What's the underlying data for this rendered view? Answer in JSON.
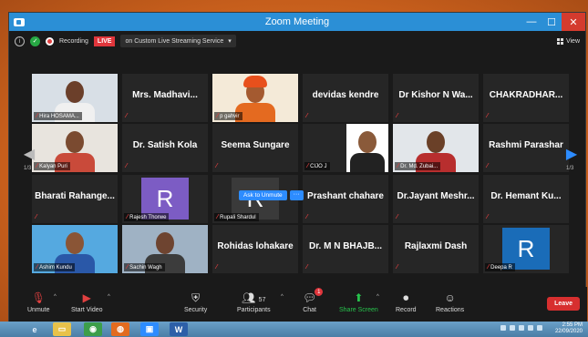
{
  "window": {
    "title": "Zoom Meeting"
  },
  "topbar": {
    "recording_label": "Recording",
    "live_label": "LIVE",
    "stream_label": "on Custom Live Streaming Service",
    "view_label": "View"
  },
  "pagination": {
    "left": "1/3",
    "right": "1/3"
  },
  "hover": {
    "ask_to_unmute": "Ask to Unmute",
    "more": "···"
  },
  "tiles": [
    {
      "name": "Hira HOSAMA...",
      "kind": "photo"
    },
    {
      "name": "Mrs. Madhavi...",
      "kind": "name"
    },
    {
      "name": "p gahvir",
      "kind": "photo"
    },
    {
      "name": "devidas kendre",
      "kind": "name"
    },
    {
      "name": "Dr Kishor N Wa...",
      "kind": "name"
    },
    {
      "name": "CHAKRADHAR...",
      "kind": "name"
    },
    {
      "name": "Kalyan Puri",
      "kind": "photo"
    },
    {
      "name": "Dr. Satish Kola",
      "kind": "name"
    },
    {
      "name": "Seema Sungare",
      "kind": "name"
    },
    {
      "name": "CIJO J",
      "kind": "photo"
    },
    {
      "name": "Dr. Md. Zubai...",
      "kind": "photo"
    },
    {
      "name": "Rashmi Parashar",
      "kind": "name"
    },
    {
      "name": "Bharati  Rahange...",
      "kind": "name"
    },
    {
      "name": "Rajesh Thorwe",
      "kind": "avatar",
      "initial": "R",
      "color": "#7c5cc4"
    },
    {
      "name": "Rupali Shardul",
      "kind": "avatar",
      "initial": "R",
      "color": "#3a3a3a"
    },
    {
      "name": "Prashant  chahare",
      "kind": "name"
    },
    {
      "name": "Dr.Jayant  Meshr...",
      "kind": "name"
    },
    {
      "name": "Dr. Hemant Ku...",
      "kind": "name"
    },
    {
      "name": "Ashim Kundu",
      "kind": "photo"
    },
    {
      "name": "Sachin Wagh",
      "kind": "photo"
    },
    {
      "name": "Rohidas lohakare",
      "kind": "name"
    },
    {
      "name": "Dr. M N BHAJB...",
      "kind": "name"
    },
    {
      "name": "Rajlaxmi Dash",
      "kind": "name"
    },
    {
      "name": "Deepa R",
      "kind": "avatar",
      "initial": "R",
      "color": "#1a6cb8"
    }
  ],
  "toolbar": {
    "unmute": "Unmute",
    "start_video": "Start Video",
    "security": "Security",
    "participants": "Participants",
    "participants_count": "57",
    "chat": "Chat",
    "chat_badge": "1",
    "share_screen": "Share Screen",
    "record": "Record",
    "reactions": "Reactions",
    "leave": "Leave"
  },
  "taskbar": {
    "time": "2:55 PM",
    "date": "22/09/2020"
  },
  "colors": {
    "accent": "#2b8fd6",
    "leave": "#d72f2f",
    "share": "#27c24c",
    "active_speaker": "#9be03a"
  }
}
